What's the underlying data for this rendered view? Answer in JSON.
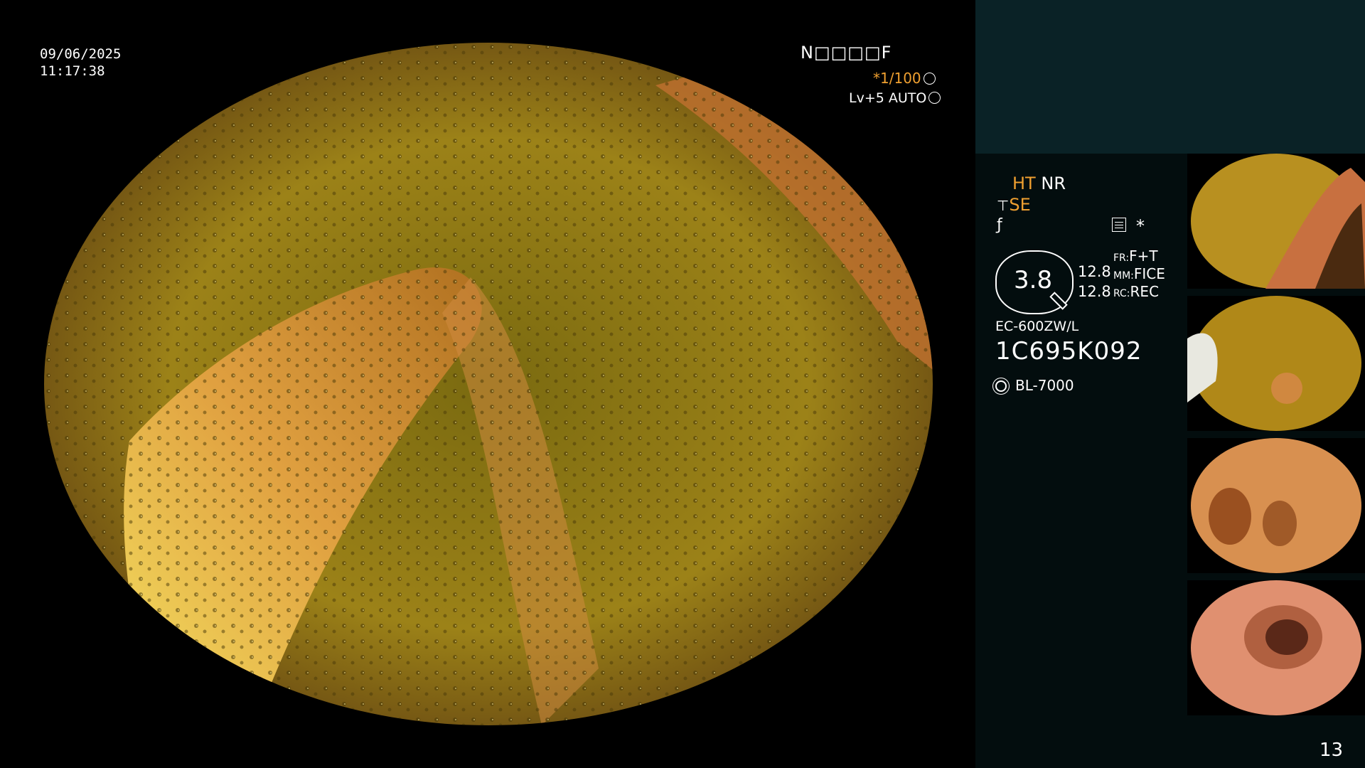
{
  "overlay": {
    "date": "09/06/2025",
    "time": "11:17:38",
    "patient_id": "N□□□□F",
    "shutter": "*1/100",
    "level": "Lv+5 AUTO"
  },
  "sidebar": {
    "ht_label": "HT",
    "nr_label": "NR",
    "se_label": "SE",
    "dial_value": "3.8",
    "values": [
      "12.8",
      "12.8"
    ],
    "fr_label": "FR:",
    "fr_value": "F+T",
    "mm_label": "MM:",
    "mm_value": "FICE",
    "rc_label": "RC:",
    "rc_value": "REC",
    "scope_model": "EC-600ZW/L",
    "serial": "1C695K092",
    "light_source": "BL-7000",
    "page_number": "13"
  },
  "colors": {
    "sidebar_bg": "#030d0e",
    "sidebar_header_bg": "#0a2226",
    "accent": "#f0a030"
  }
}
